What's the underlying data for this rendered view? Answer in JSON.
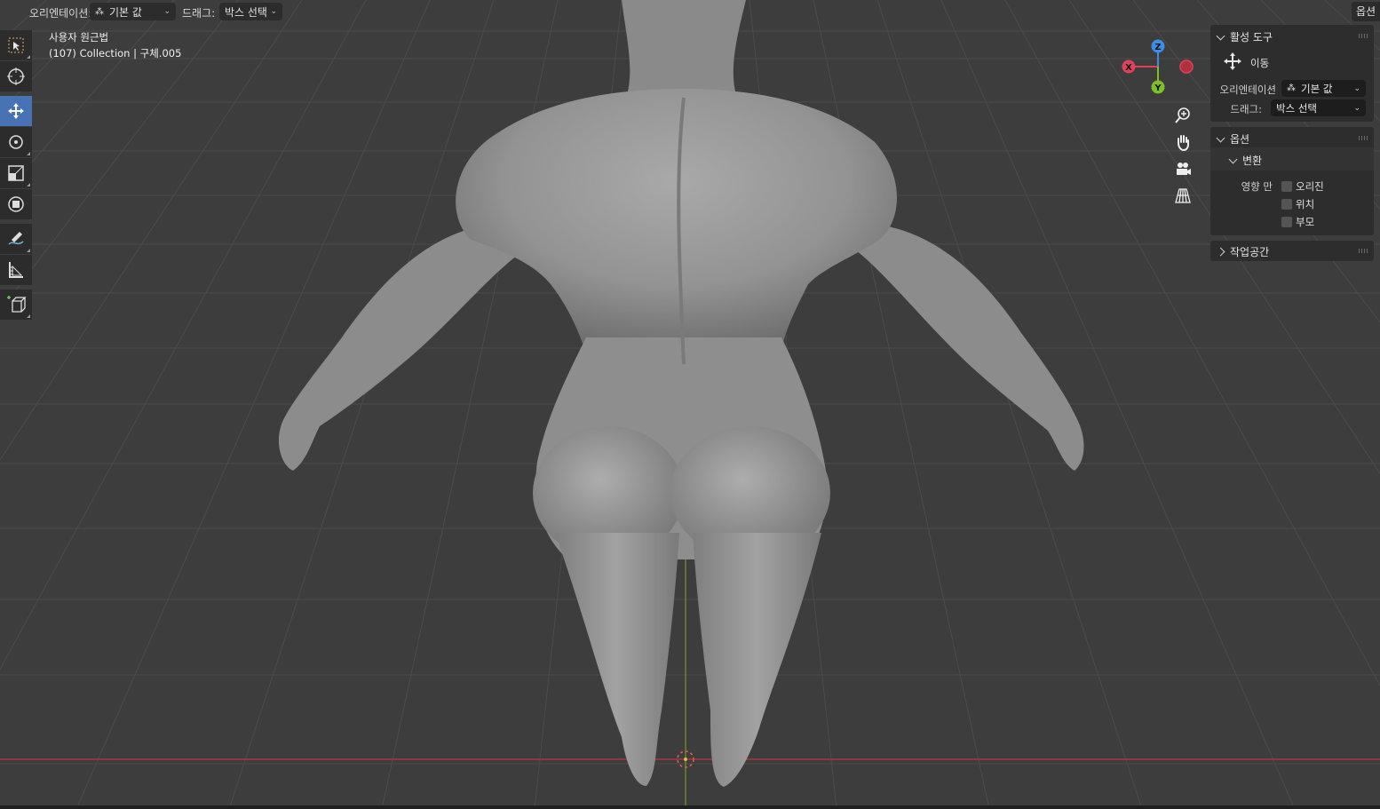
{
  "header": {
    "orientation_label": "오리엔테이션:",
    "orientation_value": "기본 값",
    "drag_label": "드래그:",
    "drag_value": "박스 선택",
    "options_button": "옵션"
  },
  "viewport_overlay": {
    "view_name": "사용자 원근법",
    "object_info": "(107) Collection | 구체.005"
  },
  "toolbar": {
    "tools": [
      {
        "name": "select-box",
        "active": false
      },
      {
        "name": "cursor",
        "active": false
      },
      {
        "name": "move",
        "active": true
      },
      {
        "name": "rotate",
        "active": false
      },
      {
        "name": "scale",
        "active": false
      },
      {
        "name": "transform",
        "active": false
      },
      {
        "name": "annotate",
        "active": false
      },
      {
        "name": "measure",
        "active": false
      },
      {
        "name": "add-cube",
        "active": false
      }
    ]
  },
  "gizmo": {
    "x_label": "X",
    "y_label": "Y",
    "z_label": "Z",
    "x_color": "#e0415a",
    "y_color": "#7fbf21",
    "z_color": "#3a8ee6"
  },
  "nav_buttons": [
    "zoom-icon",
    "hand-pan-icon",
    "camera-icon",
    "grid-perspective-icon"
  ],
  "side_panel": {
    "active_tool": {
      "title": "활성 도구",
      "tool_name": "이동",
      "orientation_label": "오리엔테이션",
      "orientation_value": "기본 값",
      "drag_label": "드래그:",
      "drag_value": "박스 선택"
    },
    "options": {
      "title": "옵션",
      "transform_title": "변환",
      "affect_only_label": "영향 만",
      "checkboxes": [
        {
          "label": "오리진",
          "checked": false
        },
        {
          "label": "위치",
          "checked": false
        },
        {
          "label": "부모",
          "checked": false
        }
      ]
    },
    "workspace": {
      "title": "작업공간"
    }
  },
  "colors": {
    "viewport_bg": "#3d3d3d",
    "grid_line": "#4b4b4b",
    "x_axis": "#b8383f",
    "y_axis": "#6f9a22",
    "active_tool": "#4772b3",
    "panel_bg": "#2d2d2d"
  }
}
